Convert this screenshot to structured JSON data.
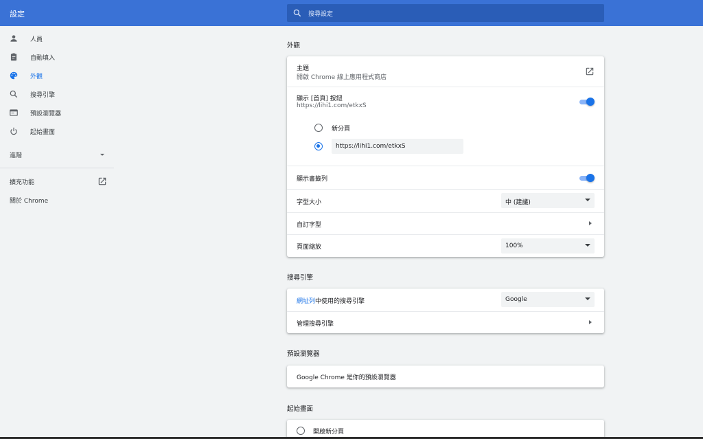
{
  "header": {
    "title": "設定",
    "search_placeholder": "搜尋設定"
  },
  "sidebar": {
    "items": [
      {
        "label": "人員",
        "icon": "person-icon"
      },
      {
        "label": "自動填入",
        "icon": "clipboard-icon"
      },
      {
        "label": "外觀",
        "icon": "palette-icon"
      },
      {
        "label": "搜尋引擎",
        "icon": "search-icon"
      },
      {
        "label": "預設瀏覽器",
        "icon": "browser-icon"
      },
      {
        "label": "起始畫面",
        "icon": "power-icon"
      }
    ],
    "active_item": "外觀",
    "advanced_label": "進階",
    "extensions_label": "擴充功能",
    "about_label": "關於 Chrome"
  },
  "appearance": {
    "section_title": "外觀",
    "theme_title": "主題",
    "theme_subtitle": "開啟 Chrome 線上應用程式商店",
    "home_button_title": "顯示 [首頁] 按鈕",
    "home_button_url": "https://lihi1.com/etkxS",
    "home_button_enabled": true,
    "radio_new_tab_label": "新分頁",
    "radio_custom_value": "https://lihi1.com/etkxS",
    "radio_selected": "custom",
    "bookmarks_bar_title": "顯示書籤列",
    "bookmarks_bar_enabled": true,
    "font_size_label": "字型大小",
    "font_size_value": "中 (建議)",
    "custom_fonts_label": "自訂字型",
    "page_zoom_label": "頁面縮放",
    "page_zoom_value": "100%"
  },
  "search_engine": {
    "section_title": "搜尋引擎",
    "address_bar_link": "網址列",
    "address_bar_rest": "中使用的搜尋引擎",
    "engine_value": "Google",
    "manage_label": "管理搜尋引擎"
  },
  "default_browser": {
    "section_title": "預設瀏覽器",
    "status_text": "Google Chrome 是你的預設瀏覽器"
  },
  "startup": {
    "section_title": "起始畫面",
    "option_new_tab": "開啟新分頁"
  },
  "colors": {
    "header_blue": "#3a72d6",
    "accent": "#1a73e8"
  }
}
